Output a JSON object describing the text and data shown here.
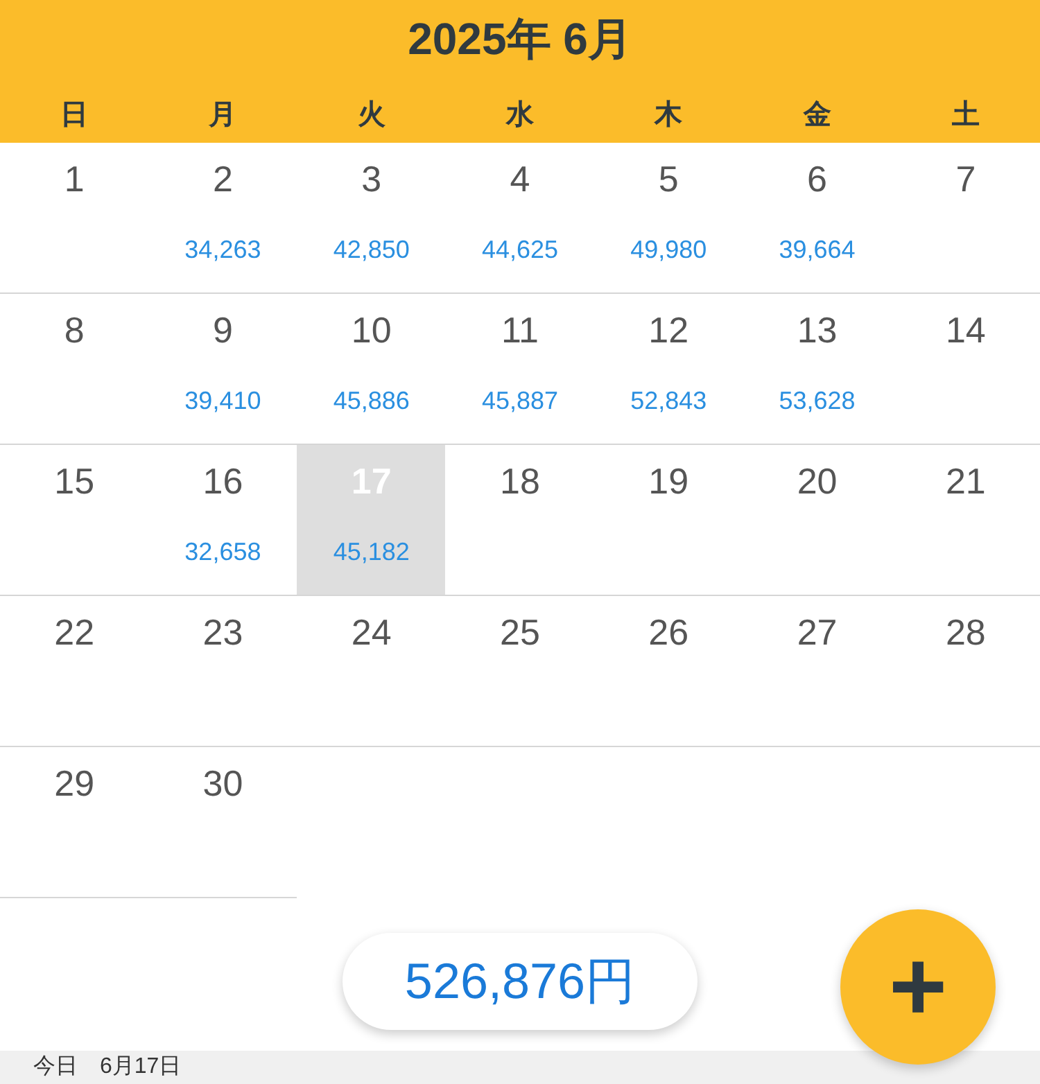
{
  "header": {
    "title": "2025年 6月",
    "weekdays": [
      "日",
      "月",
      "火",
      "水",
      "木",
      "金",
      "土"
    ]
  },
  "weeks": [
    [
      {
        "day": "1",
        "selected": false
      },
      {
        "day": "2",
        "amount": "34,263",
        "selected": false
      },
      {
        "day": "3",
        "amount": "42,850",
        "selected": false
      },
      {
        "day": "4",
        "amount": "44,625",
        "selected": false
      },
      {
        "day": "5",
        "amount": "49,980",
        "selected": false
      },
      {
        "day": "6",
        "amount": "39,664",
        "selected": false
      },
      {
        "day": "7",
        "selected": false
      }
    ],
    [
      {
        "day": "8",
        "selected": false
      },
      {
        "day": "9",
        "amount": "39,410",
        "selected": false
      },
      {
        "day": "10",
        "amount": "45,886",
        "selected": false
      },
      {
        "day": "11",
        "amount": "45,887",
        "selected": false
      },
      {
        "day": "12",
        "amount": "52,843",
        "selected": false
      },
      {
        "day": "13",
        "amount": "53,628",
        "selected": false
      },
      {
        "day": "14",
        "selected": false
      }
    ],
    [
      {
        "day": "15",
        "selected": false
      },
      {
        "day": "16",
        "amount": "32,658",
        "selected": false
      },
      {
        "day": "17",
        "amount": "45,182",
        "selected": true
      },
      {
        "day": "18",
        "selected": false
      },
      {
        "day": "19",
        "selected": false
      },
      {
        "day": "20",
        "selected": false
      },
      {
        "day": "21",
        "selected": false
      }
    ],
    [
      {
        "day": "22",
        "selected": false
      },
      {
        "day": "23",
        "selected": false
      },
      {
        "day": "24",
        "selected": false
      },
      {
        "day": "25",
        "selected": false
      },
      {
        "day": "26",
        "selected": false
      },
      {
        "day": "27",
        "selected": false
      },
      {
        "day": "28",
        "selected": false
      }
    ],
    [
      {
        "day": "29",
        "selected": false
      },
      {
        "day": "30",
        "selected": false
      }
    ]
  ],
  "total": "526,876円",
  "add_button": "+",
  "footer": "今日　6月17日"
}
